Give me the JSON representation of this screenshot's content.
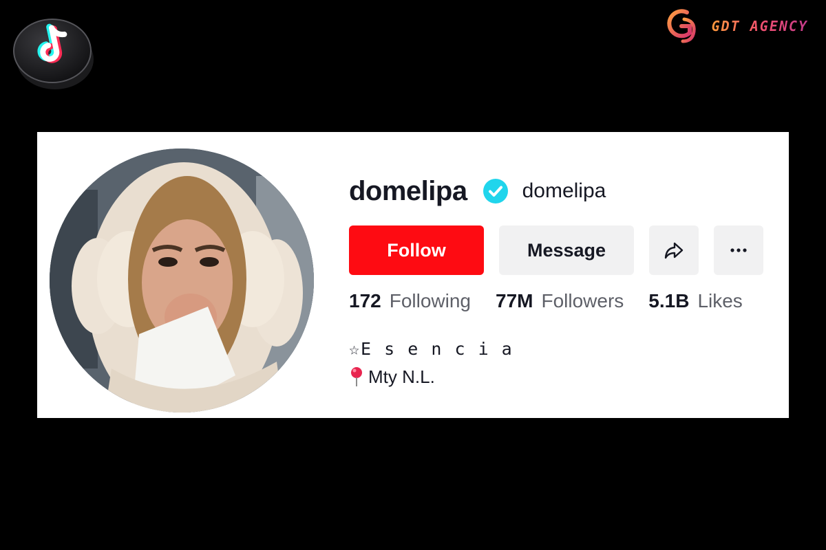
{
  "brand": {
    "name": "GDT AGENCY"
  },
  "profile": {
    "display_name": "domelipa",
    "handle": "domelipa",
    "verified": true
  },
  "buttons": {
    "follow": "Follow",
    "message": "Message",
    "share_icon": "share-arrow-icon",
    "more_icon": "more-dots-icon"
  },
  "stats": [
    {
      "value": "172",
      "label": "Following"
    },
    {
      "value": "77M",
      "label": "Followers"
    },
    {
      "value": "5.1B",
      "label": "Likes"
    }
  ],
  "bio": {
    "line1": "☆E s e n c i a",
    "line2": "Mty N.L."
  },
  "colors": {
    "follow_button": "#fe0b12",
    "verified_badge": "#20d5ec",
    "secondary_button": "#f1f1f2"
  }
}
